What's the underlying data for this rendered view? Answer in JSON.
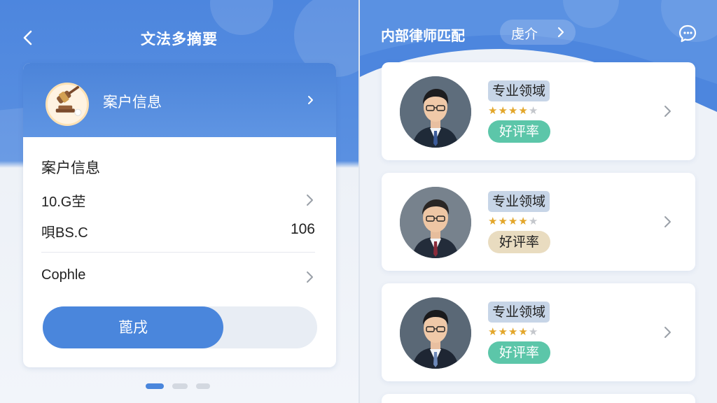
{
  "colors": {
    "brand_blue": "#4a86dc",
    "teal_badge": "#5cc6a9",
    "beige_badge": "#e9dcc0",
    "star_on": "#e3a62a",
    "star_off": "#c4c7cc"
  },
  "left_screen": {
    "title": "文法多摘要",
    "back_icon": "chevron-left-icon",
    "card_header": {
      "label": "案户信息",
      "icon": "gavel-icon"
    },
    "section_title": "案户信息",
    "rows": [
      {
        "label": "10.G茔",
        "value": ""
      },
      {
        "label": "唄BS.C",
        "value": "106"
      },
      {
        "label": "Cophle",
        "value": ""
      }
    ],
    "primary_button": "蓖戌",
    "pager": {
      "pages": 3,
      "active": 1
    }
  },
  "right_screen": {
    "title": "内部律师匹配",
    "pill_label": "虔介",
    "chat_icon": "chat-bubble-icon",
    "lawyers": [
      {
        "field_tag": "专业领域",
        "stars_filled": 4,
        "stars_total": 5,
        "rating_label": "好评率",
        "rating_style": "teal"
      },
      {
        "field_tag": "专业领域",
        "stars_filled": 4,
        "stars_total": 5,
        "rating_label": "好评率",
        "rating_style": "beige"
      },
      {
        "field_tag": "专业领域",
        "stars_filled": 4,
        "stars_total": 5,
        "rating_label": "好评率",
        "rating_style": "teal"
      }
    ]
  }
}
